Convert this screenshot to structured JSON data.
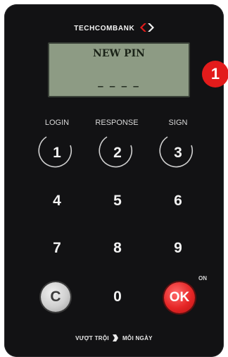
{
  "brand": {
    "name": "TECHCOMBANK"
  },
  "display": {
    "line1": "NEW PIN",
    "line2": "_ _ _ _"
  },
  "callout": {
    "number": "1"
  },
  "function_labels": [
    "LOGIN",
    "RESPONSE",
    "SIGN"
  ],
  "keys": {
    "k1": "1",
    "k2": "2",
    "k3": "3",
    "k4": "4",
    "k5": "5",
    "k6": "6",
    "k7": "7",
    "k8": "8",
    "k9": "9",
    "clear": "C",
    "k0": "0",
    "ok": "OK"
  },
  "on_label": "ON",
  "slogan": {
    "left": "VƯỢT TRỘI",
    "right": "MỖI NGÀY"
  },
  "colors": {
    "body": "#121214",
    "lcd": "#8d9b84",
    "accent": "#e31b1b"
  }
}
